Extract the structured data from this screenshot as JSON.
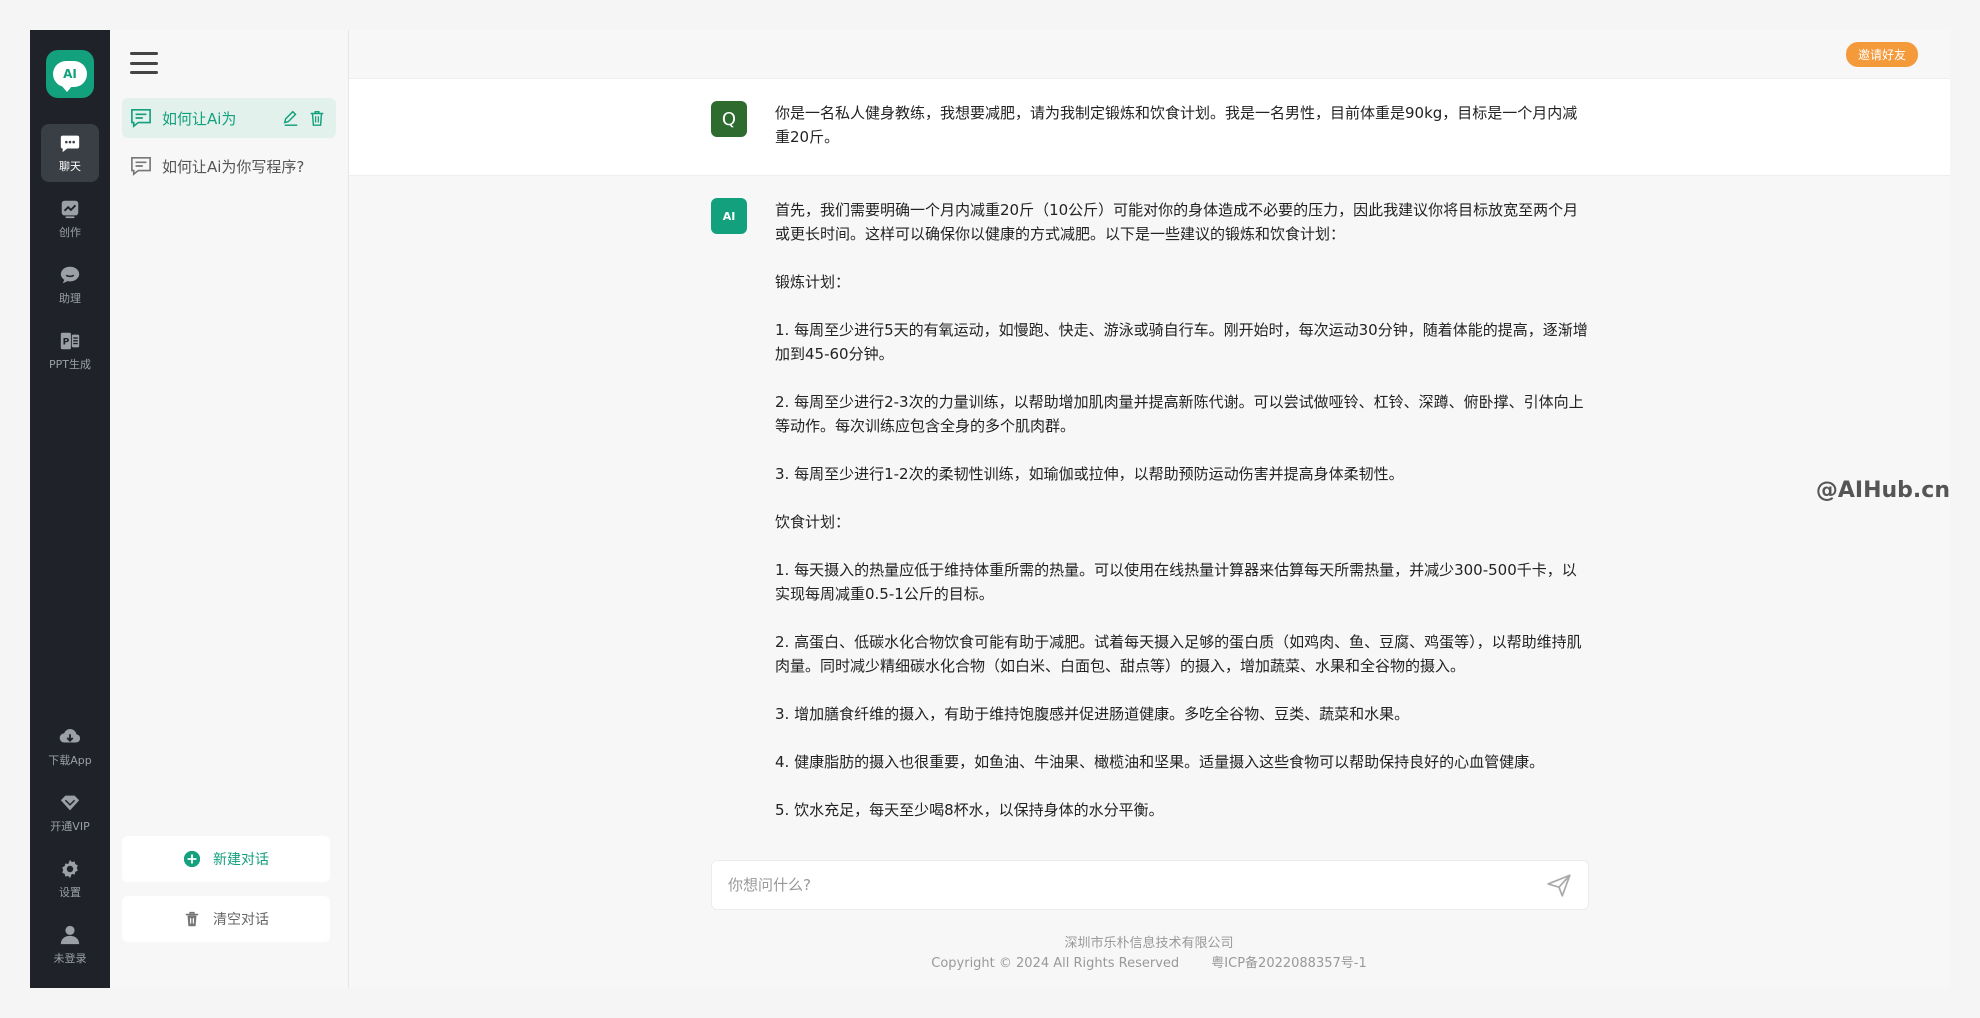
{
  "rail": {
    "logo_text": "AI",
    "items_top": [
      {
        "label": "聊天",
        "icon": "chat-icon",
        "active": true
      },
      {
        "label": "创作",
        "icon": "create-icon",
        "active": false
      },
      {
        "label": "助理",
        "icon": "assistant-icon",
        "active": false
      },
      {
        "label": "PPT生成",
        "icon": "ppt-icon",
        "active": false
      }
    ],
    "items_bottom": [
      {
        "label": "下载App",
        "icon": "download-icon"
      },
      {
        "label": "开通VIP",
        "icon": "vip-icon"
      },
      {
        "label": "设置",
        "icon": "gear-icon"
      },
      {
        "label": "未登录",
        "icon": "user-icon"
      }
    ]
  },
  "sidebar": {
    "conversations": [
      {
        "label": "如何让Ai为",
        "active": true
      },
      {
        "label": "如何让Ai为你写程序?",
        "active": false
      }
    ],
    "new_chat_label": "新建对话",
    "clear_label": "清空对话"
  },
  "header": {
    "invite_label": "邀请好友"
  },
  "user_message": {
    "avatar": "Q",
    "text": "你是一名私人健身教练，我想要减肥，请为我制定锻炼和饮食计划。我是一名男性，目前体重是90kg，目标是一个月内减重20斤。"
  },
  "ai_message": {
    "avatar": "AI",
    "paragraphs": [
      "首先，我们需要明确一个月内减重20斤（10公斤）可能对你的身体造成不必要的压力，因此我建议你将目标放宽至两个月或更长时间。这样可以确保你以健康的方式减肥。以下是一些建议的锻炼和饮食计划：",
      "锻炼计划：",
      "1. 每周至少进行5天的有氧运动，如慢跑、快走、游泳或骑自行车。刚开始时，每次运动30分钟，随着体能的提高，逐渐增加到45-60分钟。",
      "2. 每周至少进行2-3次的力量训练，以帮助增加肌肉量并提高新陈代谢。可以尝试做哑铃、杠铃、深蹲、俯卧撑、引体向上等动作。每次训练应包含全身的多个肌肉群。",
      "3. 每周至少进行1-2次的柔韧性训练，如瑜伽或拉伸，以帮助预防运动伤害并提高身体柔韧性。",
      "饮食计划：",
      "1. 每天摄入的热量应低于维持体重所需的热量。可以使用在线热量计算器来估算每天所需热量，并减少300-500千卡，以实现每周减重0.5-1公斤的目标。",
      "2. 高蛋白、低碳水化合物饮食可能有助于减肥。试着每天摄入足够的蛋白质（如鸡肉、鱼、豆腐、鸡蛋等），以帮助维持肌肉量。同时减少精细碳水化合物（如白米、白面包、甜点等）的摄入，增加蔬菜、水果和全谷物的摄入。",
      "3. 增加膳食纤维的摄入，有助于维持饱腹感并促进肠道健康。多吃全谷物、豆类、蔬菜和水果。",
      "4. 健康脂肪的摄入也很重要，如鱼油、牛油果、橄榄油和坚果。适量摄入这些食物可以帮助保持良好的心血管健康。",
      "5. 饮水充足，每天至少喝8杯水，以保持身体的水分平衡。"
    ]
  },
  "watermark": "@AIHub.cn",
  "input": {
    "placeholder": "你想问什么?"
  },
  "footer": {
    "company": "深圳市乐朴信息技术有限公司",
    "copyright": "Copyright © 2024 All Rights Reserved",
    "icp": "粤ICP备2022088357号-1"
  },
  "colors": {
    "accent": "#13a07d",
    "rail_bg": "#1f2329",
    "invite": "#f59a3b"
  }
}
